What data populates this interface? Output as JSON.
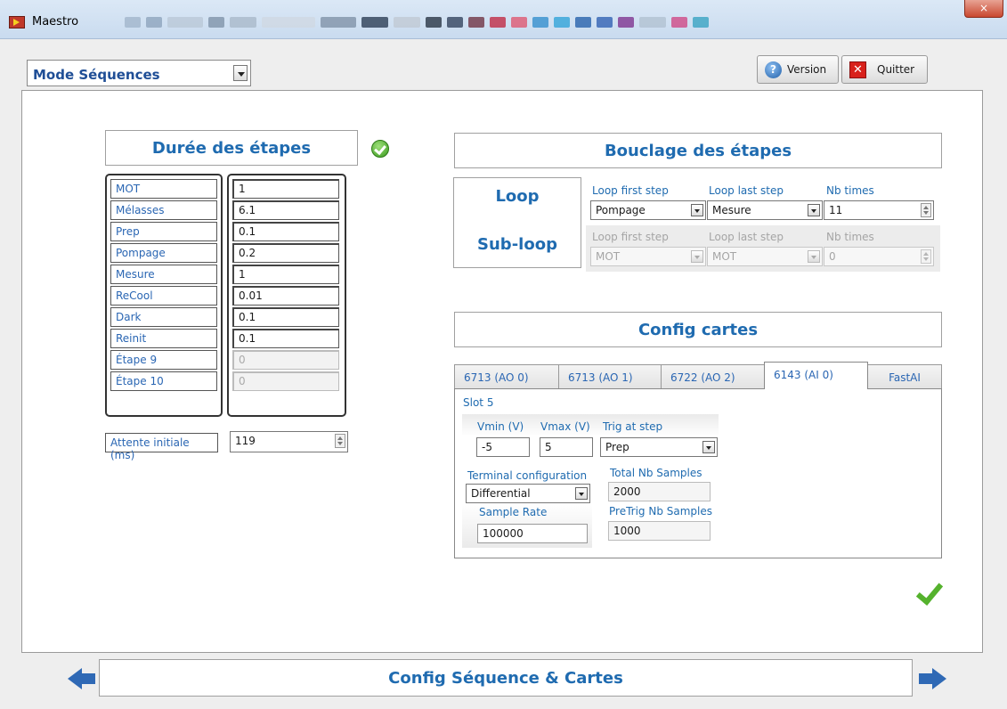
{
  "window": {
    "title": "Maestro",
    "close_glyph": "×"
  },
  "toolbar": {
    "mode_select": "Mode Séquences",
    "version_label": "Version",
    "quit_label": "Quitter",
    "version_icon": "?",
    "quit_icon": "✕"
  },
  "durations": {
    "header": "Durée des étapes",
    "steps": [
      {
        "label": "MOT",
        "value": "1",
        "enabled": true
      },
      {
        "label": "Mélasses",
        "value": "6.1",
        "enabled": true
      },
      {
        "label": "Prep",
        "value": "0.1",
        "enabled": true
      },
      {
        "label": "Pompage",
        "value": "0.2",
        "enabled": true
      },
      {
        "label": "Mesure",
        "value": "1",
        "enabled": true
      },
      {
        "label": "ReCool",
        "value": "0.01",
        "enabled": true
      },
      {
        "label": "Dark",
        "value": "0.1",
        "enabled": true
      },
      {
        "label": "Reinit",
        "value": "0.1",
        "enabled": true
      },
      {
        "label": "Étape 9",
        "value": "0",
        "enabled": false
      },
      {
        "label": "Étape 10",
        "value": "0",
        "enabled": false
      }
    ],
    "initial_wait_label": "Attente initiale (ms)",
    "initial_wait_value": "119"
  },
  "looping": {
    "header": "Bouclage des étapes",
    "loop_label": "Loop",
    "subloop_label": "Sub-loop",
    "first_step_label": "Loop first step",
    "last_step_label": "Loop last step",
    "nb_times_label": "Nb times",
    "loop": {
      "first": "Pompage",
      "last": "Mesure",
      "times": "11"
    },
    "subloop": {
      "first": "MOT",
      "last": "MOT",
      "times": "0"
    }
  },
  "cards": {
    "header": "Config cartes",
    "tabs": [
      "6713 (AO 0)",
      "6713 (AO 1)",
      "6722 (AO 2)",
      "6143 (AI 0)",
      "FastAI"
    ],
    "active_tab": "6143 (AI 0)",
    "slot": "Slot 5",
    "vmin_label": "Vmin (V)",
    "vmin": "-5",
    "vmax_label": "Vmax (V)",
    "vmax": "5",
    "trig_label": "Trig at step",
    "trig": "Prep",
    "terminal_label": "Terminal configuration",
    "terminal": "Differential",
    "total_samples_label": "Total Nb Samples",
    "total_samples": "2000",
    "sample_rate_label": "Sample Rate",
    "sample_rate": "100000",
    "pretrig_label": "PreTrig Nb Samples",
    "pretrig": "1000"
  },
  "footer": {
    "title": "Config Séquence & Cartes"
  },
  "colors": {
    "accent": "#1f6bb0",
    "ok": "#55b22d"
  }
}
